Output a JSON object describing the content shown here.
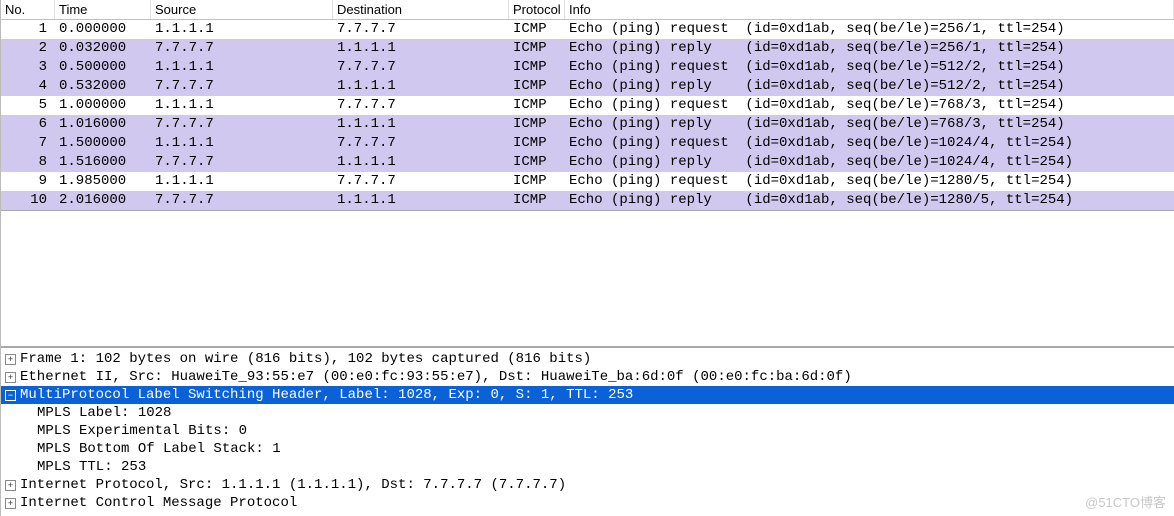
{
  "columns": {
    "no": "No.",
    "time": "Time",
    "source": "Source",
    "destination": "Destination",
    "protocol": "Protocol",
    "info": "Info"
  },
  "packets": [
    {
      "no": "1",
      "time": "0.000000",
      "src": "1.1.1.1",
      "dst": "7.7.7.7",
      "proto": "ICMP",
      "info": "Echo (ping) request  (id=0xd1ab, seq(be/le)=256/1, ttl=254)",
      "bg": "white"
    },
    {
      "no": "2",
      "time": "0.032000",
      "src": "7.7.7.7",
      "dst": "1.1.1.1",
      "proto": "ICMP",
      "info": "Echo (ping) reply    (id=0xd1ab, seq(be/le)=256/1, ttl=254)",
      "bg": "lavender"
    },
    {
      "no": "3",
      "time": "0.500000",
      "src": "1.1.1.1",
      "dst": "7.7.7.7",
      "proto": "ICMP",
      "info": "Echo (ping) request  (id=0xd1ab, seq(be/le)=512/2, ttl=254)",
      "bg": "lavender"
    },
    {
      "no": "4",
      "time": "0.532000",
      "src": "7.7.7.7",
      "dst": "1.1.1.1",
      "proto": "ICMP",
      "info": "Echo (ping) reply    (id=0xd1ab, seq(be/le)=512/2, ttl=254)",
      "bg": "lavender"
    },
    {
      "no": "5",
      "time": "1.000000",
      "src": "1.1.1.1",
      "dst": "7.7.7.7",
      "proto": "ICMP",
      "info": "Echo (ping) request  (id=0xd1ab, seq(be/le)=768/3, ttl=254)",
      "bg": "white"
    },
    {
      "no": "6",
      "time": "1.016000",
      "src": "7.7.7.7",
      "dst": "1.1.1.1",
      "proto": "ICMP",
      "info": "Echo (ping) reply    (id=0xd1ab, seq(be/le)=768/3, ttl=254)",
      "bg": "lavender"
    },
    {
      "no": "7",
      "time": "1.500000",
      "src": "1.1.1.1",
      "dst": "7.7.7.7",
      "proto": "ICMP",
      "info": "Echo (ping) request  (id=0xd1ab, seq(be/le)=1024/4, ttl=254)",
      "bg": "lavender"
    },
    {
      "no": "8",
      "time": "1.516000",
      "src": "7.7.7.7",
      "dst": "1.1.1.1",
      "proto": "ICMP",
      "info": "Echo (ping) reply    (id=0xd1ab, seq(be/le)=1024/4, ttl=254)",
      "bg": "lavender"
    },
    {
      "no": "9",
      "time": "1.985000",
      "src": "1.1.1.1",
      "dst": "7.7.7.7",
      "proto": "ICMP",
      "info": "Echo (ping) request  (id=0xd1ab, seq(be/le)=1280/5, ttl=254)",
      "bg": "white"
    },
    {
      "no": "10",
      "time": "2.016000",
      "src": "7.7.7.7",
      "dst": "1.1.1.1",
      "proto": "ICMP",
      "info": "Echo (ping) reply    (id=0xd1ab, seq(be/le)=1280/5, ttl=254)",
      "bg": "lavender"
    }
  ],
  "details": {
    "frame": "Frame 1: 102 bytes on wire (816 bits), 102 bytes captured (816 bits)",
    "ethernet": "Ethernet II, Src: HuaweiTe_93:55:e7 (00:e0:fc:93:55:e7), Dst: HuaweiTe_ba:6d:0f (00:e0:fc:ba:6d:0f)",
    "mpls": "MultiProtocol Label Switching Header, Label: 1028, Exp: 0, S: 1, TTL: 253",
    "mpls_children": [
      "MPLS Label: 1028",
      "MPLS Experimental Bits: 0",
      "MPLS Bottom Of Label Stack: 1",
      "MPLS TTL: 253"
    ],
    "ip": "Internet Protocol, Src: 1.1.1.1 (1.1.1.1), Dst: 7.7.7.7 (7.7.7.7)",
    "icmp": "Internet Control Message Protocol"
  },
  "watermark": "@51CTO博客"
}
